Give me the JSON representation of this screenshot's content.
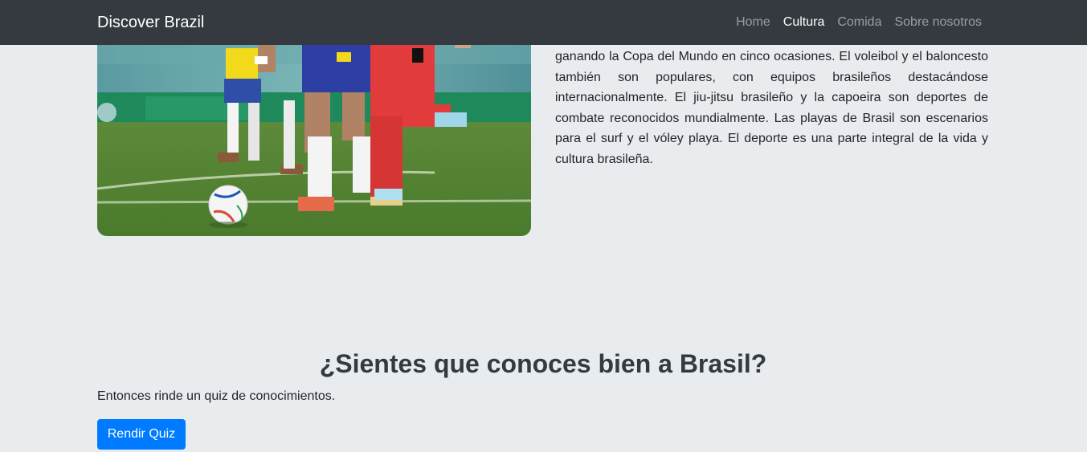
{
  "navbar": {
    "brand": "Discover Brazil",
    "links": [
      {
        "label": "Home",
        "active": false
      },
      {
        "label": "Cultura",
        "active": true
      },
      {
        "label": "Comida",
        "active": false
      },
      {
        "label": "Sobre nosotros",
        "active": false
      }
    ]
  },
  "sports_section": {
    "image_subject": "soccer-players-photo",
    "paragraph": "ganando la Copa del Mundo en cinco ocasiones. El voleibol y el baloncesto también son populares, con equipos brasileños destacándose internacionalmente. El jiu-jitsu brasileño y la capoeira son deportes de combate reconocidos mundialmente. Las playas de Brasil son escenarios para el surf y el vóley playa. El deporte es una parte integral de la vida y cultura brasileña."
  },
  "quiz": {
    "heading": "¿Sientes que conoces bien a Brasil?",
    "text": "Entonces rinde un quiz de conocimientos.",
    "button_label": "Rendir Quiz"
  },
  "colors": {
    "navbar_bg": "#343a40",
    "page_bg": "#e9ecef",
    "button_bg": "#007bff"
  }
}
